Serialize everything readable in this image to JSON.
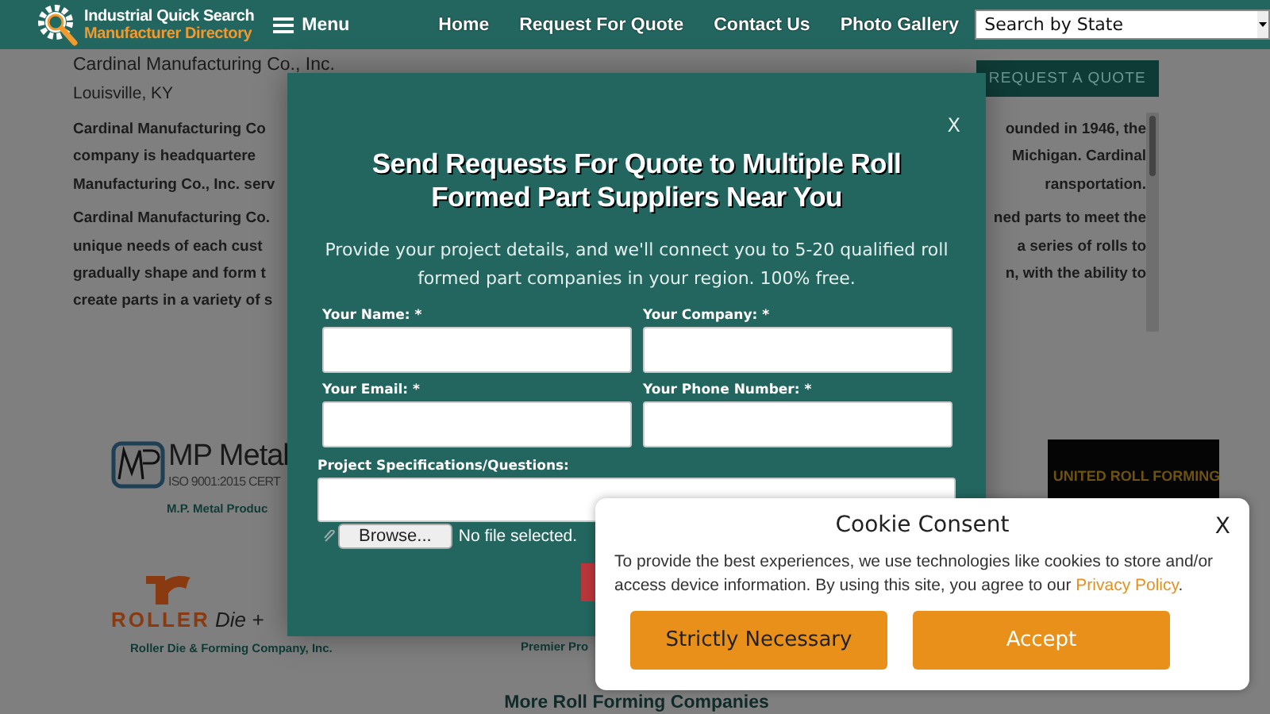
{
  "header": {
    "logo_line1": "Industrial Quick Search",
    "logo_line2": "Manufacturer Directory",
    "menu": "Menu",
    "nav": [
      "Home",
      "Request For Quote",
      "Contact Us",
      "Photo Gallery"
    ],
    "state_select": {
      "value": "Search by State"
    }
  },
  "company": {
    "name": "Cardinal Manufacturing Co., Inc.",
    "location": "Louisville, KY",
    "request_button": "REQUEST A QUOTE",
    "paragraphs": [
      [
        {
          "left": "Cardinal Manufacturing Co",
          "right": "ounded in 1946, the"
        },
        {
          "left": "company is headquartere",
          "right": "Michigan. Cardinal"
        },
        {
          "left": "Manufacturing Co., Inc. serv",
          "right": "ransportation."
        }
      ],
      [
        {
          "left": "Cardinal Manufacturing Co.",
          "right": "ned parts to meet the"
        },
        {
          "left": "unique needs of each cust",
          "right": "a series of rolls to"
        },
        {
          "left": "gradually shape and form t",
          "right": "n, with the ability to"
        },
        {
          "left": "create parts in a variety of s"
        }
      ]
    ]
  },
  "featured": [
    {
      "kind": "mp",
      "logo_texts": [
        "MP Metal",
        "ISO 9001:2015 CERT"
      ],
      "caption": "M.P. Metal Produc"
    },
    {
      "kind": "united",
      "logo_texts": [
        "UNITED ROLL FORMING"
      ]
    },
    {
      "kind": "roller",
      "logo_texts": [
        "ROLLER",
        "Die +"
      ],
      "caption": "Roller Die & Forming Company, Inc."
    },
    {
      "kind": "premier",
      "caption": "Premier Pro"
    }
  ],
  "more_heading": "More Roll Forming Companies",
  "quote_modal": {
    "close": "X",
    "title": "Send Requests For Quote to Multiple Roll Formed Part Suppliers Near You",
    "intro": "Provide your project details, and we'll connect you to 5-20 qualified roll formed part companies in your region. 100% free.",
    "fields": [
      {
        "label": "Your Name: *"
      },
      {
        "label": "Your Company: *"
      },
      {
        "label": "Your Email: *"
      },
      {
        "label": "Your Phone Number: *"
      }
    ],
    "specs_label": "Project Specifications/Questions:",
    "file": {
      "button": "Browse...",
      "status": "No file selected."
    }
  },
  "cookie_consent": {
    "title": "Cookie Consent",
    "close": "X",
    "text": "To provide the best experiences, we use technologies like cookies to store and/or access device information. By using this site, you agree to our ",
    "link": "Privacy Policy",
    "text_end": ".",
    "buttons": [
      {
        "label": "Strictly Necessary",
        "kind": "necessary"
      },
      {
        "label": "Accept",
        "kind": "accept"
      }
    ]
  }
}
